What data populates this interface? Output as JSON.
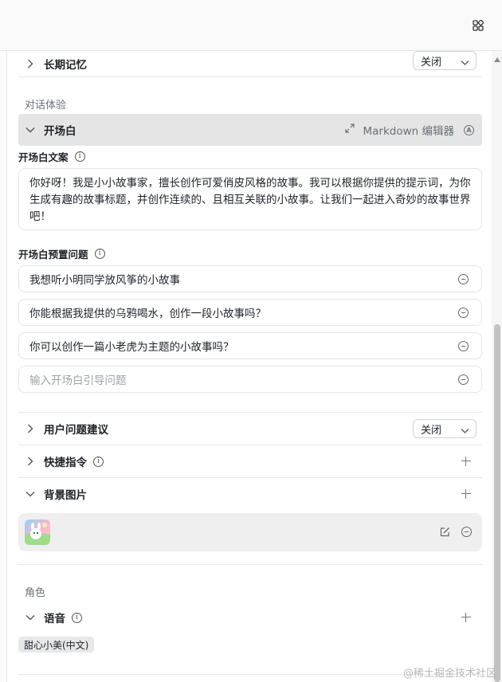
{
  "sections": {
    "long_term_memory": {
      "title": "长期记忆",
      "select_value": "关闭"
    },
    "dialog_experience_label": "对话体验",
    "opening": {
      "title": "开场白",
      "markdown_editor_label": "Markdown 编辑器",
      "a_icon_text": "A",
      "text_label": "开场白文案",
      "text_value": "你好呀！我是小小故事家，擅长创作可爱俏皮风格的故事。我可以根据你提供的提示词，为你生成有趣的故事标题，并创作连续的、且相互关联的小故事。让我们一起进入奇妙的故事世界吧！",
      "preset_label": "开场白预置问题",
      "questions": [
        "我想听小明同学放风筝的小故事",
        "你能根据我提供的乌鸦喝水，创作一段小故事吗？",
        "你可以创作一篇小老虎为主题的小故事吗？"
      ],
      "question_placeholder": "输入开场白引导问题"
    },
    "user_suggestions": {
      "title": "用户问题建议",
      "select_value": "关闭"
    },
    "shortcuts": {
      "title": "快捷指令"
    },
    "background_image": {
      "title": "背景图片"
    },
    "role_label": "角色",
    "voice": {
      "title": "语音",
      "tag": "甜心小美(中文)"
    }
  },
  "info_icon_glyph": "i",
  "watermark": "@稀土掘金技术社区"
}
